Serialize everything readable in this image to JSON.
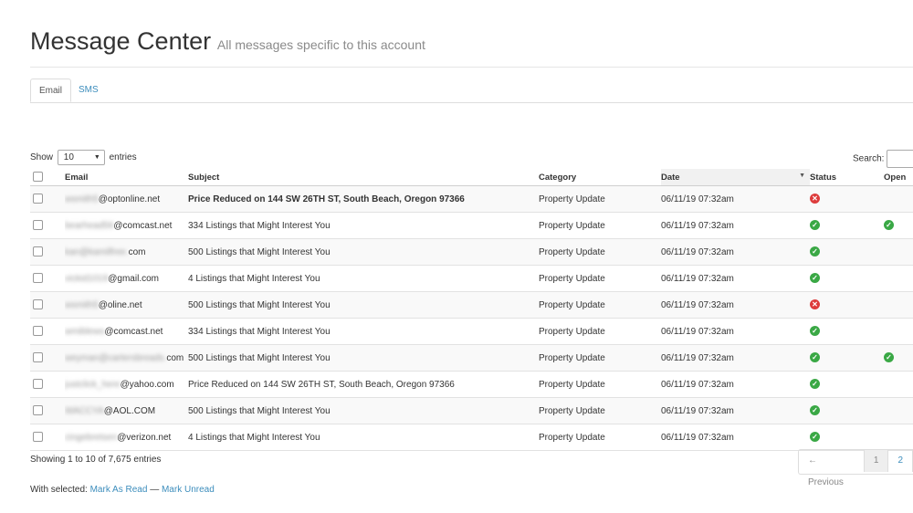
{
  "header": {
    "title": "Message Center",
    "subtitle": "All messages specific to this account"
  },
  "tabs": [
    {
      "label": "Email",
      "active": true
    },
    {
      "label": "SMS",
      "active": false
    }
  ],
  "controls": {
    "show_label": "Show",
    "entries_value": "10",
    "entries_label": "entries",
    "search_label": "Search:"
  },
  "table": {
    "columns": [
      "Email",
      "Subject",
      "Category",
      "Date",
      "Status",
      "Open"
    ],
    "rows": [
      {
        "email_hidden": "wsmith5",
        "email_visible": "@optonline.net",
        "subject": "Price Reduced on 144 SW 26TH ST, South Beach, Oregon 97366",
        "unread": true,
        "category": "Property Update",
        "date": "06/11/19 07:32am",
        "status": "failed",
        "opened": false
      },
      {
        "email_hidden": "bearhead56",
        "email_visible": "@comcast.net",
        "subject": "334 Listings that Might Interest You",
        "unread": false,
        "category": "Property Update",
        "date": "06/11/19 07:32am",
        "status": "delivered",
        "opened": true
      },
      {
        "email_hidden": "kan@kamilfree.",
        "email_visible": "com",
        "subject": "500 Listings that Might Interest You",
        "unread": false,
        "category": "Property Update",
        "date": "06/11/19 07:32am",
        "status": "delivered",
        "opened": false
      },
      {
        "email_hidden": "vickid1019",
        "email_visible": "@gmail.com",
        "subject": "4 Listings that Might Interest You",
        "unread": false,
        "category": "Property Update",
        "date": "06/11/19 07:32am",
        "status": "delivered",
        "opened": false
      },
      {
        "email_hidden": "wsmith5",
        "email_visible": "@oline.net",
        "subject": "500 Listings that Might Interest You",
        "unread": false,
        "category": "Property Update",
        "date": "06/11/19 07:32am",
        "status": "failed",
        "opened": false
      },
      {
        "email_hidden": "wmiblews",
        "email_visible": "@comcast.net",
        "subject": "334 Listings that Might Interest You",
        "unread": false,
        "category": "Property Update",
        "date": "06/11/19 07:32am",
        "status": "delivered",
        "opened": false
      },
      {
        "email_hidden": "weyman@cartersbreads.",
        "email_visible": "com",
        "subject": "500 Listings that Might Interest You",
        "unread": false,
        "category": "Property Update",
        "date": "06/11/19 07:32am",
        "status": "delivered",
        "opened": true
      },
      {
        "email_hidden": "justclick_here",
        "email_visible": "@yahoo.com",
        "subject": "Price Reduced on 144 SW 26TH ST, South Beach, Oregon 97366",
        "unread": false,
        "category": "Property Update",
        "date": "06/11/19 07:32am",
        "status": "delivered",
        "opened": false
      },
      {
        "email_hidden": "WACCYA",
        "email_visible": "@AOL.COM",
        "subject": "500 Listings that Might Interest You",
        "unread": false,
        "category": "Property Update",
        "date": "06/11/19 07:32am",
        "status": "delivered",
        "opened": false
      },
      {
        "email_hidden": "cingebretsen",
        "email_visible": "@verizon.net",
        "subject": "4 Listings that Might Interest You",
        "unread": false,
        "category": "Property Update",
        "date": "06/11/19 07:32am",
        "status": "delivered",
        "opened": false
      }
    ]
  },
  "footer": {
    "info": "Showing 1 to 10 of 7,675 entries",
    "pagination": {
      "previous": "← Previous",
      "pages": [
        "1",
        "2"
      ],
      "current": "1"
    },
    "with_selected": "With selected:",
    "mark_read": "Mark As Read",
    "separator": "—",
    "mark_unread": "Mark Unread"
  },
  "colors": {
    "accent": "#3c8dbc",
    "success": "#3aa845",
    "danger": "#dd3c3c"
  }
}
